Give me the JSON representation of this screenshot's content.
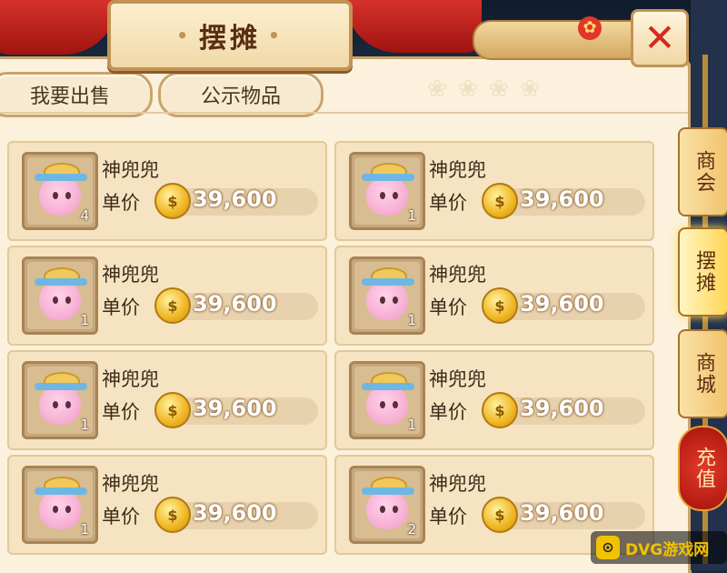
{
  "window": {
    "title": "摆摊",
    "close_symbol": "✕"
  },
  "tabs": [
    {
      "label": "我要出售"
    },
    {
      "label": "公示物品"
    }
  ],
  "items": [
    {
      "name": "神兜兜",
      "unit_label": "单价",
      "price": "39,600",
      "qty": "4",
      "coin": "$"
    },
    {
      "name": "神兜兜",
      "unit_label": "单价",
      "price": "39,600",
      "qty": "1",
      "coin": "$"
    },
    {
      "name": "神兜兜",
      "unit_label": "单价",
      "price": "39,600",
      "qty": "1",
      "coin": "$"
    },
    {
      "name": "神兜兜",
      "unit_label": "单价",
      "price": "39,600",
      "qty": "1",
      "coin": "$"
    },
    {
      "name": "神兜兜",
      "unit_label": "单价",
      "price": "39,600",
      "qty": "1",
      "coin": "$"
    },
    {
      "name": "神兜兜",
      "unit_label": "单价",
      "price": "39,600",
      "qty": "1",
      "coin": "$"
    },
    {
      "name": "神兜兜",
      "unit_label": "单价",
      "price": "39,600",
      "qty": "1",
      "coin": "$"
    },
    {
      "name": "神兜兜",
      "unit_label": "单价",
      "price": "39,600",
      "qty": "2",
      "coin": "$"
    }
  ],
  "side_menu": [
    {
      "label": "商会",
      "state": "normal"
    },
    {
      "label": "摆摊",
      "state": "active"
    },
    {
      "label": "商城",
      "state": "normal"
    },
    {
      "label": "充值",
      "state": "recharge"
    }
  ],
  "watermark": {
    "icon": "⊙",
    "text": "DVG游戏网"
  },
  "colors": {
    "accent_red": "#d42a1f",
    "parchment": "#fbf1dc",
    "gold": "#f0b522"
  }
}
